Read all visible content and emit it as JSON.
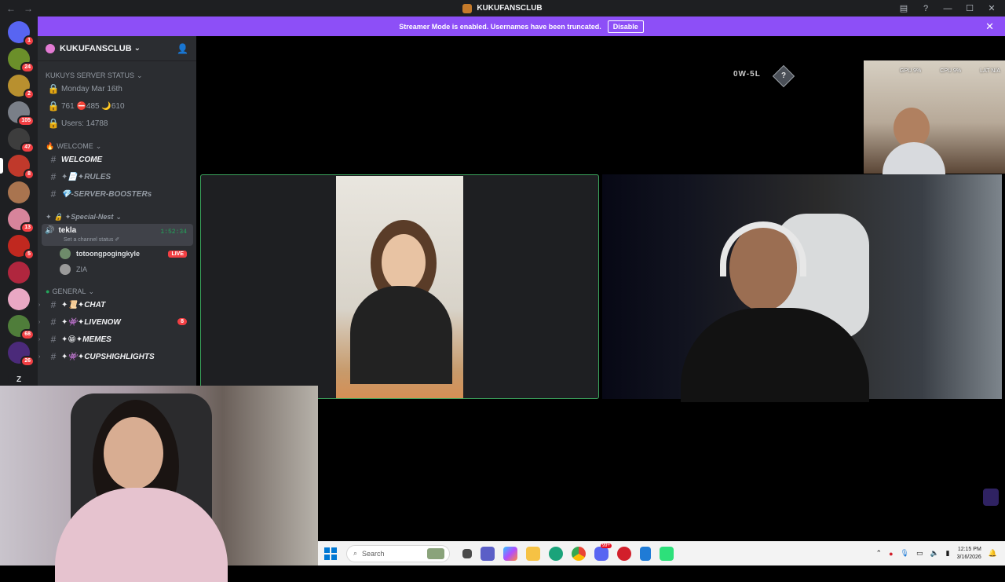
{
  "window": {
    "title": "KUKUFANSCLUB",
    "back": "←",
    "forward": "→",
    "inbox_icon": "inbox-icon",
    "help": "?",
    "minimize": "—",
    "maximize": "☐",
    "close": "✕"
  },
  "banner": {
    "text": "Streamer Mode is enabled. Usernames have been truncated.",
    "button": "Disable",
    "close": "✕"
  },
  "guilds": [
    {
      "name": "discord-home",
      "badge": "1",
      "color": "#5865f2"
    },
    {
      "name": "server-1",
      "badge": "24",
      "color": "#6b8f2a"
    },
    {
      "name": "server-2",
      "badge": "2",
      "color": "#b8902f"
    },
    {
      "name": "server-3",
      "badge": "105",
      "color": "#7a7f88"
    },
    {
      "name": "server-4",
      "badge": "47",
      "color": "#3d3d3d"
    },
    {
      "name": "server-5",
      "badge": "8",
      "color": "#c0392b",
      "active": true
    },
    {
      "name": "server-6",
      "badge": "",
      "color": "#a9744f"
    },
    {
      "name": "server-7",
      "badge": "13",
      "color": "#d7849b"
    },
    {
      "name": "server-8",
      "badge": "5",
      "color": "#c0281f"
    },
    {
      "name": "server-9",
      "badge": "",
      "color": "#b0263e"
    },
    {
      "name": "server-10",
      "badge": "",
      "color": "#e9a8c4"
    },
    {
      "name": "server-11",
      "badge": "68",
      "color": "#4f7d3a"
    },
    {
      "name": "server-12",
      "badge": "26",
      "color": "#4b2a7a"
    },
    {
      "name": "server-z",
      "badge": "",
      "color": "#1e1f22",
      "letter": "Z"
    },
    {
      "name": "server-14",
      "badge": "",
      "color": "#d0d0d0"
    }
  ],
  "server": {
    "name": "KUKUFANSCLUB",
    "chevron": "⌄",
    "invite_icon": "add-member-icon"
  },
  "categories": {
    "status": "KUKUYS SERVER STATUS",
    "welcome": "WELCOME",
    "special": "✦Special-Nest",
    "general": "GENERAL"
  },
  "status_channels": [
    {
      "text": "Monday Mar 16th"
    },
    {
      "text": "761 ⛔485 🌙610"
    },
    {
      "text": "Users: 14788"
    }
  ],
  "welcome_channels": [
    {
      "text": "WELCOME"
    },
    {
      "text": "✦📄✦RULES"
    },
    {
      "text": "💎-SERVER-BOOSTERs"
    }
  ],
  "voice": {
    "name": "tekla",
    "status": "Set a channel status ✐",
    "time": "1:52:34",
    "users": [
      {
        "name": "totoongpogingkyle",
        "live": "LIVE"
      },
      {
        "name": "ZIA",
        "live": ""
      }
    ]
  },
  "general_channels": [
    {
      "text": "✦📜✦CHAT",
      "badge": ""
    },
    {
      "text": "✦👾✦LIVENOW",
      "badge": "8"
    },
    {
      "text": "✦😁✦MEMES",
      "badge": ""
    },
    {
      "text": "✦👾✦CUPSHIGHLIGHTS",
      "badge": ""
    }
  ],
  "overlay": {
    "score": "0W-5L",
    "rank": "?",
    "hud": {
      "gpu": "GPU 9%",
      "cpu": "CPU 9%",
      "lat": "LAT N/A"
    }
  },
  "taskbar": {
    "search_placeholder": "Search",
    "time": "12:15 PM",
    "date": "3/16/2026",
    "discord_badge": "99+"
  }
}
